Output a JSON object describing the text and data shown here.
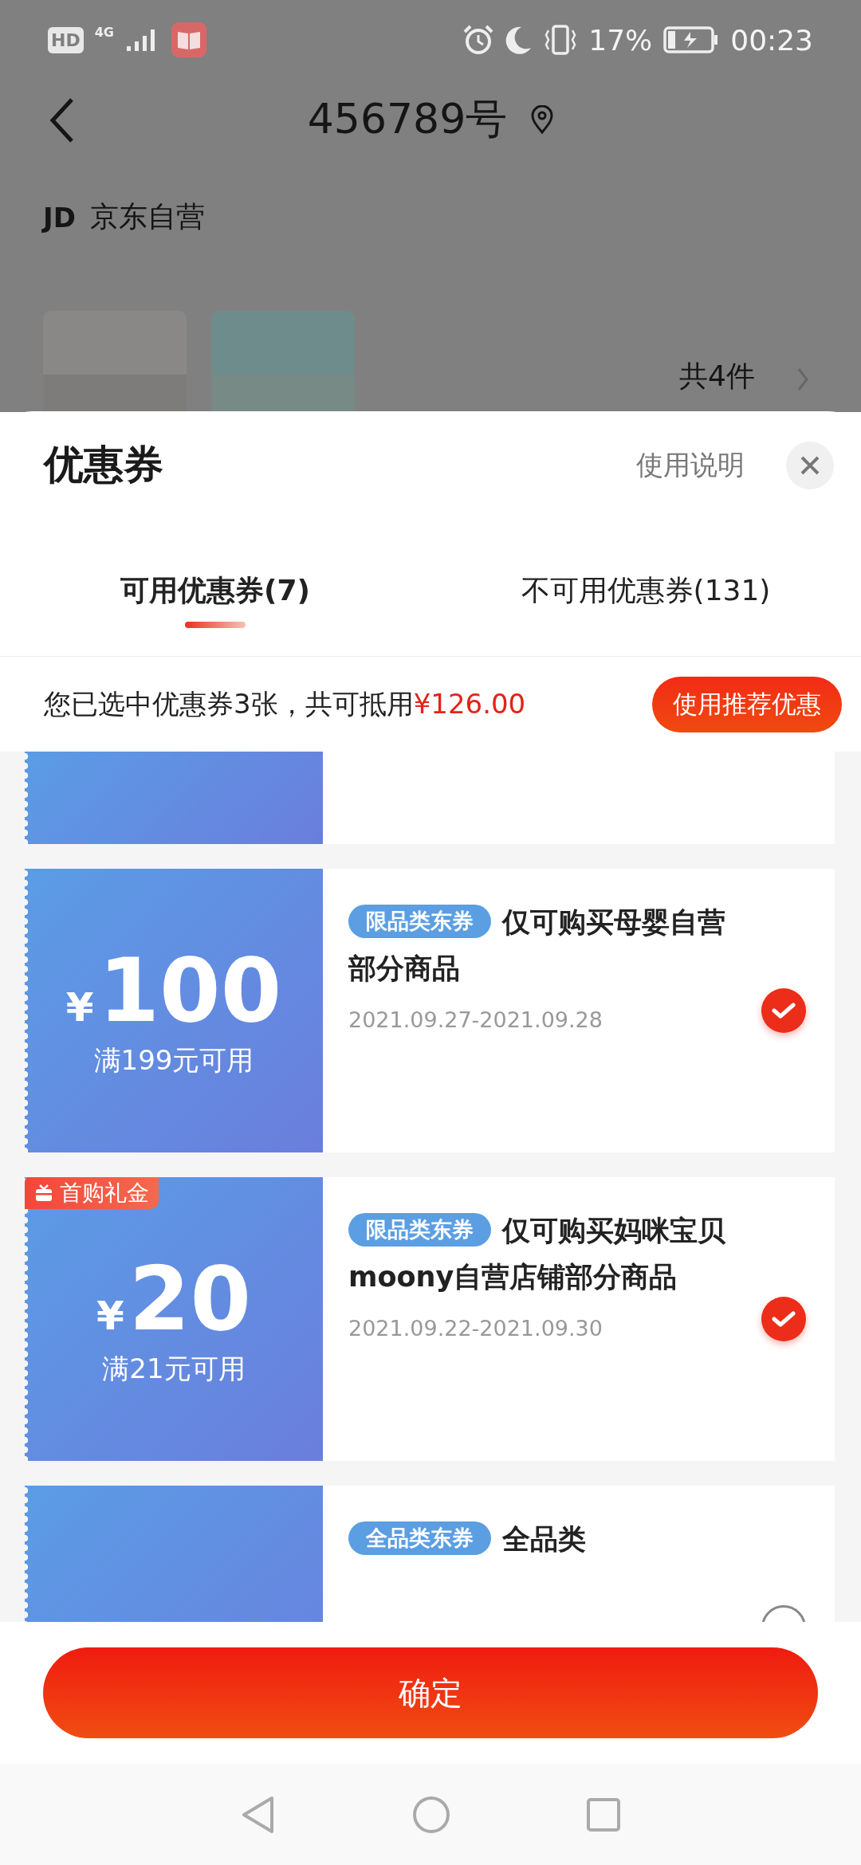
{
  "status_bar": {
    "hd": "HD",
    "network": "4G",
    "battery": "17%",
    "time": "00:23"
  },
  "header": {
    "title": "456789号"
  },
  "store": {
    "logo": "JD",
    "name": "京东自营",
    "count": "共4件"
  },
  "sheet": {
    "title": "优惠券",
    "help": "使用说明",
    "tabs": [
      {
        "label": "可用优惠券(7)",
        "selected": true
      },
      {
        "label": "不可用优惠券(131)",
        "selected": false
      }
    ],
    "summary": {
      "text": "您已选中优惠券3张，共可抵用",
      "amount": "¥126.00",
      "button": "使用推荐优惠"
    },
    "coupons": [
      {
        "kind": "clipped_top"
      },
      {
        "kind": "full",
        "currency": "¥",
        "amount": "100",
        "condition": "满199元可用",
        "tag": "限品类东券",
        "title": "仅可购买母婴自营部分商品",
        "dates": "2021.09.27-2021.09.28",
        "selected": true
      },
      {
        "kind": "full",
        "badge": "首购礼金",
        "currency": "¥",
        "amount": "20",
        "condition": "满21元可用",
        "tag": "限品类东券",
        "title": "仅可购买妈咪宝贝moony自营店铺部分商品",
        "dates": "2021.09.22-2021.09.30",
        "selected": true
      },
      {
        "kind": "clipped_bottom",
        "tag": "全品类东券",
        "title": "全品类",
        "selected": false
      }
    ],
    "confirm": "确定"
  }
}
